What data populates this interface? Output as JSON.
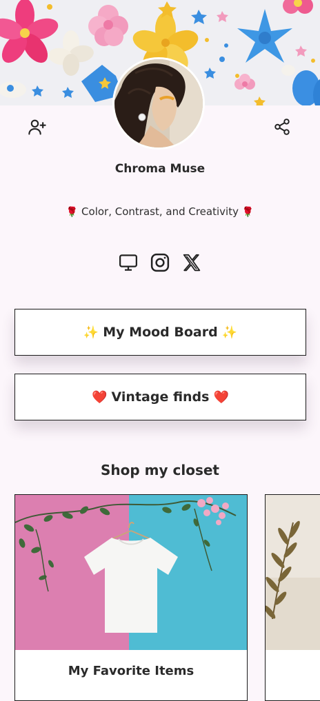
{
  "profile": {
    "name": "Chroma Muse",
    "bio_text": "Color, Contrast, and Creativity",
    "bio_emoji": "🌹"
  },
  "header": {
    "follow_icon": "add-user-icon",
    "share_icon": "share-icon"
  },
  "socials": [
    {
      "name": "website",
      "icon": "monitor-icon"
    },
    {
      "name": "instagram",
      "icon": "instagram-icon"
    },
    {
      "name": "x",
      "icon": "x-icon"
    }
  ],
  "links": [
    {
      "label": "My Mood Board",
      "emoji": "✨"
    },
    {
      "label": "Vintage finds",
      "emoji": "❤️"
    }
  ],
  "shop": {
    "title": "Shop my closet",
    "cards": [
      {
        "title": "My Favorite Items"
      },
      {
        "title": ""
      }
    ]
  },
  "colors": {
    "background": "#fcf6fb",
    "border": "#1a1a1a",
    "text": "#2a2a2a"
  }
}
